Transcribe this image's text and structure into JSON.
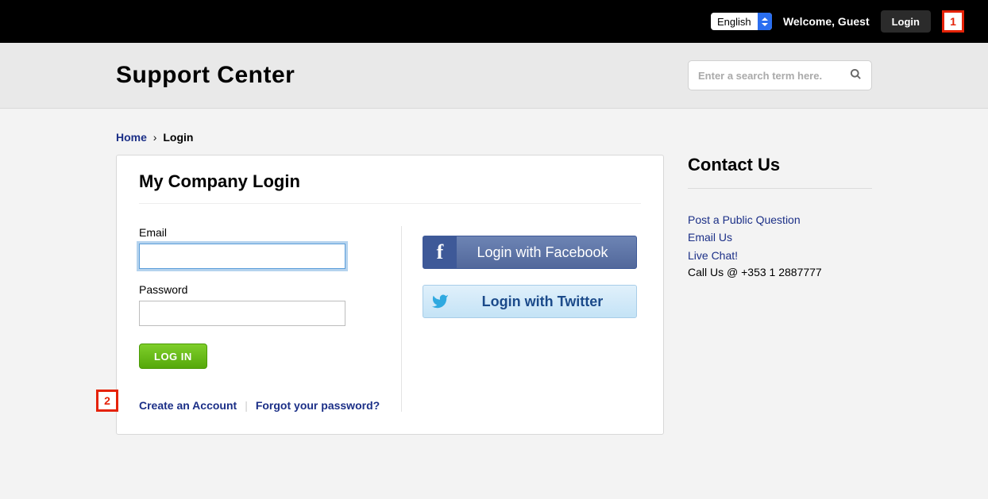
{
  "topbar": {
    "language_selected": "English",
    "welcome_text": "Welcome, Guest",
    "login_label": "Login",
    "annotation_1": "1"
  },
  "banner": {
    "title": "Support Center",
    "search_placeholder": "Enter a search term here."
  },
  "breadcrumb": {
    "home": "Home",
    "separator": "›",
    "current": "Login"
  },
  "login_card": {
    "title": "My Company Login",
    "email_label": "Email",
    "password_label": "Password",
    "submit_label": "LOG IN",
    "facebook_label": "Login with Facebook",
    "twitter_label": "Login with Twitter",
    "create_account": "Create an Account",
    "forgot_password": "Forgot your password?",
    "annotation_2": "2"
  },
  "sidebar": {
    "title": "Contact Us",
    "links": {
      "public_q": "Post a Public Question",
      "email": "Email Us",
      "chat": "Live Chat!"
    },
    "call_text": "Call Us @ +353 1 2887777"
  }
}
